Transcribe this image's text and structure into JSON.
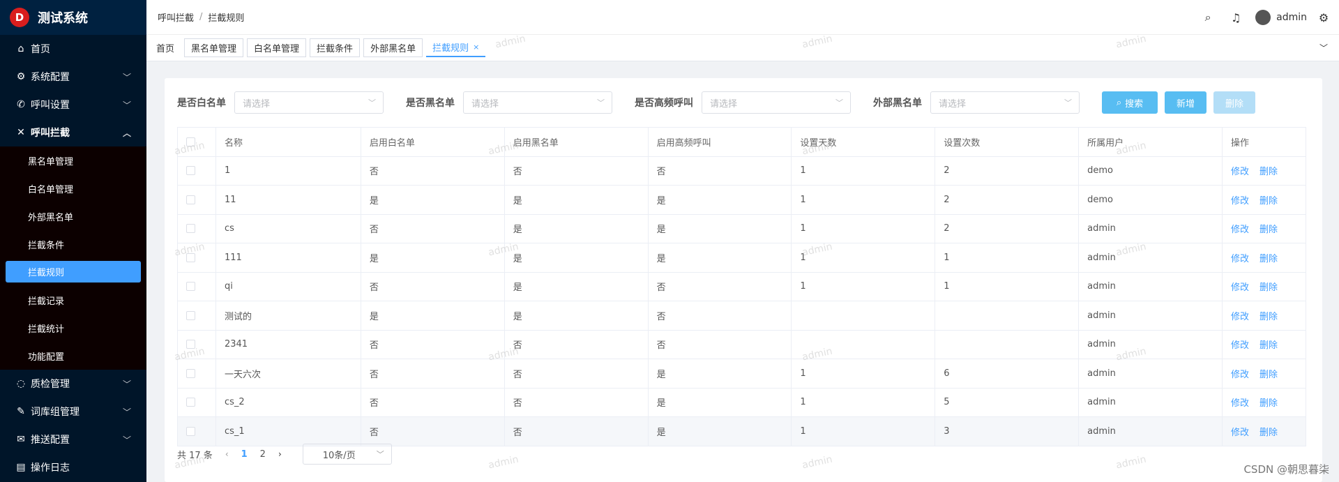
{
  "brand": {
    "logo_letter": "D",
    "name": "测试系统"
  },
  "sidebar": {
    "items": [
      {
        "label": "首页",
        "icon": "home-icon"
      },
      {
        "label": "系统配置",
        "icon": "gear-icon"
      },
      {
        "label": "呼叫设置",
        "icon": "phone-icon"
      },
      {
        "label": "呼叫拦截",
        "icon": "phone-block-icon"
      }
    ],
    "sub_items": [
      {
        "label": "黑名单管理"
      },
      {
        "label": "白名单管理"
      },
      {
        "label": "外部黑名单"
      },
      {
        "label": "拦截条件"
      },
      {
        "label": "拦截规则"
      },
      {
        "label": "拦截记录"
      },
      {
        "label": "拦截统计"
      },
      {
        "label": "功能配置"
      }
    ],
    "bottom_items": [
      {
        "label": "质检管理",
        "icon": "chat-icon"
      },
      {
        "label": "词库组管理",
        "icon": "edit-icon"
      },
      {
        "label": "推送配置",
        "icon": "mail-icon"
      },
      {
        "label": "操作日志",
        "icon": "document-icon"
      }
    ]
  },
  "header": {
    "breadcrumb": [
      "呼叫拦截",
      "拦截规则"
    ],
    "user": "admin"
  },
  "tags": [
    "首页",
    "黑名单管理",
    "白名单管理",
    "拦截条件",
    "外部黑名单",
    "拦截规则"
  ],
  "filters": [
    {
      "label": "是否白名单",
      "placeholder": "请选择"
    },
    {
      "label": "是否黑名单",
      "placeholder": "请选择"
    },
    {
      "label": "是否高频呼叫",
      "placeholder": "请选择"
    },
    {
      "label": "外部黑名单",
      "placeholder": "请选择"
    }
  ],
  "buttons": {
    "search": "搜索",
    "add": "新增",
    "delete": "删除"
  },
  "table": {
    "columns": [
      "名称",
      "启用白名单",
      "启用黑名单",
      "启用高频呼叫",
      "设置天数",
      "设置次数",
      "所属用户",
      "操作"
    ],
    "rows": [
      {
        "name": "1",
        "white": "否",
        "black": "否",
        "high": "否",
        "days": "1",
        "times": "2",
        "user": "demo"
      },
      {
        "name": "11",
        "white": "是",
        "black": "是",
        "high": "是",
        "days": "1",
        "times": "2",
        "user": "demo"
      },
      {
        "name": "cs",
        "white": "否",
        "black": "是",
        "high": "是",
        "days": "1",
        "times": "2",
        "user": "admin"
      },
      {
        "name": "111",
        "white": "是",
        "black": "是",
        "high": "是",
        "days": "1",
        "times": "1",
        "user": "admin"
      },
      {
        "name": "qi",
        "white": "否",
        "black": "是",
        "high": "否",
        "days": "1",
        "times": "1",
        "user": "admin"
      },
      {
        "name": "测试的",
        "white": "是",
        "black": "是",
        "high": "否",
        "days": "",
        "times": "",
        "user": "admin"
      },
      {
        "name": "2341",
        "white": "否",
        "black": "否",
        "high": "否",
        "days": "",
        "times": "",
        "user": "admin"
      },
      {
        "name": "一天六次",
        "white": "否",
        "black": "否",
        "high": "是",
        "days": "1",
        "times": "6",
        "user": "admin"
      },
      {
        "name": "cs_2",
        "white": "否",
        "black": "否",
        "high": "是",
        "days": "1",
        "times": "5",
        "user": "admin"
      },
      {
        "name": "cs_1",
        "white": "否",
        "black": "否",
        "high": "是",
        "days": "1",
        "times": "3",
        "user": "admin"
      }
    ],
    "action_edit": "修改",
    "action_delete": "删除"
  },
  "pager": {
    "total": "共 17 条",
    "pages": [
      "1",
      "2"
    ],
    "current": "1",
    "size": "10条/页"
  },
  "watermark": "admin",
  "footer_credit": "CSDN @朝思暮柒",
  "colors": {
    "sidebar": "#001529",
    "accent": "#409eff",
    "button": "#58bdf2"
  }
}
